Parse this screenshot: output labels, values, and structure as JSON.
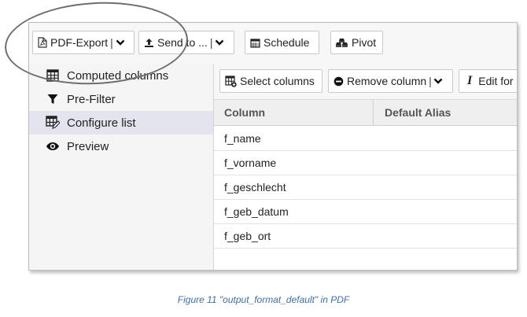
{
  "toolbar": {
    "pdf_export": "PDF-Export",
    "send_to": "Send to ...",
    "schedule": "Schedule",
    "pivot": "Pivot"
  },
  "sidebar": {
    "items": [
      {
        "label": "Computed columns",
        "icon": "table-grid-icon"
      },
      {
        "label": "Pre-Filter",
        "icon": "filter-icon"
      },
      {
        "label": "Configure list",
        "icon": "configure-list-icon",
        "active": true
      },
      {
        "label": "Preview",
        "icon": "eye-icon"
      }
    ]
  },
  "subtoolbar": {
    "select_columns": "Select columns",
    "remove_column": "Remove column",
    "edit": "Edit for"
  },
  "table": {
    "headers": [
      "Column",
      "Default Alias"
    ],
    "rows": [
      "f_name",
      "f_vorname",
      "f_geschlecht",
      "f_geb_datum",
      "f_geb_ort"
    ]
  },
  "caption": "Figure 11 \"output_format_default\" in PDF",
  "colors": {
    "active_sidebar": "#e4e4ee",
    "caption": "#3f6fa7"
  }
}
